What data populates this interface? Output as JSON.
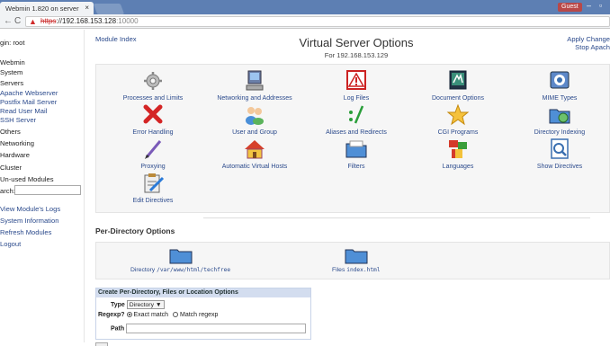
{
  "browser": {
    "tab_title": "Webmin 1.820 on server",
    "tab_close": "×",
    "guest_badge": "Guest",
    "url_scheme": "https",
    "url_host": "192.168.153.128",
    "url_port": ":10000",
    "back": "←",
    "reload": "C",
    "warn": "▲"
  },
  "sidebar": {
    "login": "gin: root",
    "items": [
      {
        "label": "Webmin"
      },
      {
        "label": "System"
      },
      {
        "label": "Servers"
      },
      {
        "label": "Apache Webserver",
        "link": true
      },
      {
        "label": "Postfix Mail Server",
        "link": true
      },
      {
        "label": "Read User Mail",
        "link": true
      },
      {
        "label": "SSH Server",
        "link": true
      },
      {
        "label": "Others"
      },
      {
        "label": "Networking"
      },
      {
        "label": "Hardware"
      },
      {
        "label": "Cluster"
      },
      {
        "label": "Un-used Modules"
      }
    ],
    "search_label": "arch:",
    "bottom_links": [
      "View Module's Logs",
      "System Information",
      "Refresh Modules",
      "Logout"
    ]
  },
  "header": {
    "module_index": "Module Index",
    "title": "Virtual Server Options",
    "subtitle": "For 192.168.153.129",
    "apply_changes": "Apply Change",
    "stop_apache": "Stop Apach"
  },
  "options": [
    {
      "label": "Processes and Limits",
      "icon": "gear-icon"
    },
    {
      "label": "Networking and Addresses",
      "icon": "network-monitor-icon"
    },
    {
      "label": "Log Files",
      "icon": "warning-icon"
    },
    {
      "label": "Document Options",
      "icon": "document-icon"
    },
    {
      "label": "MIME Types",
      "icon": "mime-icon"
    },
    {
      "label": "Error Handling",
      "icon": "error-x-icon"
    },
    {
      "label": "User and Group",
      "icon": "users-icon"
    },
    {
      "label": "Aliases and Redirects",
      "icon": "alias-icon"
    },
    {
      "label": "CGI Programs",
      "icon": "star-icon"
    },
    {
      "label": "Directory Indexing",
      "icon": "directory-index-icon"
    },
    {
      "label": "Proxying",
      "icon": "proxy-pen-icon"
    },
    {
      "label": "Automatic Virtual Hosts",
      "icon": "house-icon"
    },
    {
      "label": "Filters",
      "icon": "filter-folder-icon"
    },
    {
      "label": "Languages",
      "icon": "flags-icon"
    },
    {
      "label": "Show Directives",
      "icon": "magnifier-icon"
    },
    {
      "label": "Edit Directives",
      "icon": "edit-clipboard-icon"
    }
  ],
  "per_directory": {
    "title": "Per-Directory Options",
    "entries": [
      {
        "kind": "Directory",
        "path": "/var/www/html/techfree"
      },
      {
        "kind": "Files",
        "path": "index.html"
      }
    ]
  },
  "create_form": {
    "title": "Create Per-Directory, Files or Location Options",
    "type_label": "Type",
    "type_value": "Directory ▼",
    "regexp_label": "Regexp?",
    "exact_match": "Exact match",
    "match_regexp": "Match regexp",
    "path_label": "Path"
  },
  "colors": {
    "link": "#2b4a8c",
    "titlebar": "#5d7fb3"
  }
}
